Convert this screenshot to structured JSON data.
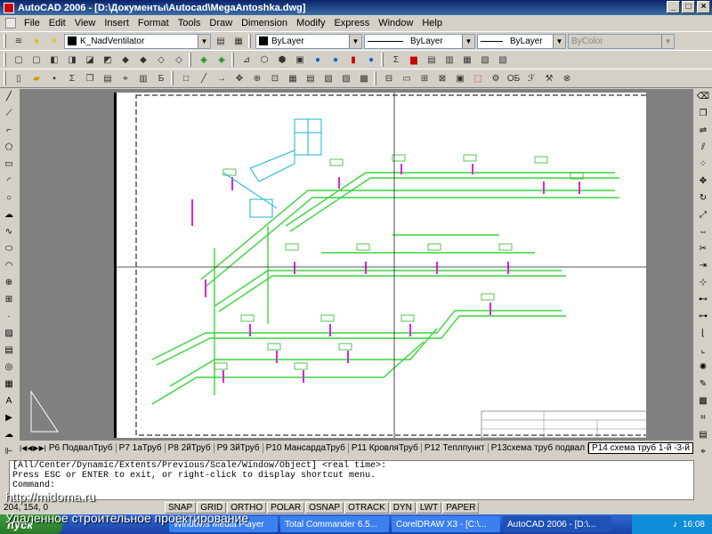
{
  "window": {
    "title": "AutoCAD 2006 - [D:\\Документы\\Autocad\\MegaAntoshka.dwg]",
    "min": "_",
    "max": "□",
    "close": "×"
  },
  "menu": [
    "File",
    "Edit",
    "View",
    "Insert",
    "Format",
    "Tools",
    "Draw",
    "Dimension",
    "Modify",
    "Express",
    "Window",
    "Help"
  ],
  "layers": {
    "current_layer": "K_NadVentilator",
    "color": "ByLayer",
    "linetype": "ByLayer",
    "lineweight": "ByLayer",
    "plotstyle": "ByColor"
  },
  "layout_tabs": [
    "P6 ПодвалТруб",
    "P7 1аТруб",
    "P8 2йТруб",
    "P9 3йТруб",
    "P10 МансардаТруб",
    "P11 КровляТруб",
    "P12 Теплпункт",
    "P13схема труб подвал",
    "P14 схема труб 1-й -3-й"
  ],
  "command": {
    "line1": "[All/Center/Dynamic/Extents/Previous/Scale/Window/Object] <real time>:",
    "line2": "Press ESC or ENTER to exit, or right-click to display shortcut menu.",
    "line3": "Command:"
  },
  "status": {
    "coords": "204, 154, 0",
    "buttons": [
      "SNAP",
      "GRID",
      "ORTHO",
      "POLAR",
      "OSNAP",
      "OTRACK",
      "DYN",
      "LWT",
      "PAPER"
    ]
  },
  "taskbar": {
    "start": "пуск",
    "tasks": [
      "Windows Media Player",
      "Total Commander 6.5...",
      "CorelDRAW X3 - [C:\\...",
      "AutoCAD 2006 - [D:\\..."
    ],
    "clock": "16:08"
  },
  "watermark": {
    "site": "http://midoma.ru",
    "tagline": "Удаленное строительное проектирование"
  }
}
